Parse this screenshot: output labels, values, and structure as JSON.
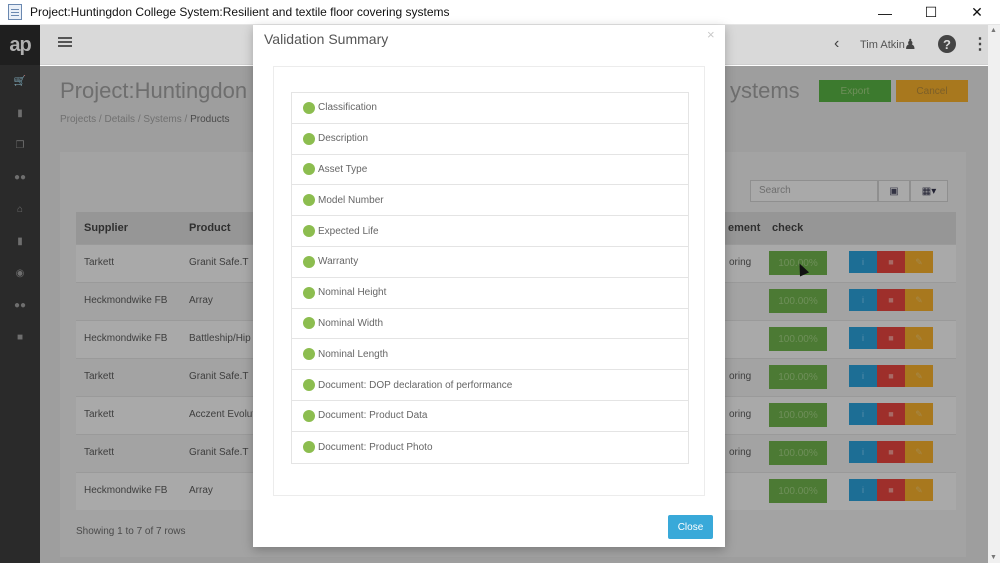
{
  "window": {
    "title": "Project:Huntingdon College System:Resilient and textile floor covering systems",
    "minimize": "—",
    "maximize": "☐",
    "close": "✕"
  },
  "sidebar": {
    "logo": "ap",
    "icons": [
      "cart-icon",
      "document-icon",
      "copy-icon",
      "users-icon",
      "home-icon",
      "file-icon",
      "globe-icon",
      "group-icon",
      "lock-icon"
    ]
  },
  "header": {
    "user_name": "Tim Atkin",
    "help": "?"
  },
  "page": {
    "title_left": "Project:Huntingdon C",
    "title_right": "ystems",
    "breadcrumbs": [
      "Projects",
      "/",
      "Details",
      "/",
      "Systems",
      "/",
      "Products"
    ],
    "export_label": "Export",
    "cancel_label": "Cancel",
    "search_placeholder": "Search",
    "columns": {
      "supplier": "Supplier",
      "product": "Product",
      "ement": "ement",
      "check": "check"
    },
    "rows": [
      {
        "supplier": "Tarkett",
        "product": "Granit Safe.T",
        "side": "oring",
        "pct": "100.00%"
      },
      {
        "supplier": "Heckmondwike FB",
        "product": "Array",
        "side": "",
        "pct": "100.00%"
      },
      {
        "supplier": "Heckmondwike FB",
        "product": "Battleship/Hip",
        "side": "",
        "pct": "100.00%"
      },
      {
        "supplier": "Tarkett",
        "product": "Granit Safe.T",
        "side": "oring",
        "pct": "100.00%"
      },
      {
        "supplier": "Tarkett",
        "product": "Acczent Evolut",
        "side": "oring",
        "pct": "100.00%"
      },
      {
        "supplier": "Tarkett",
        "product": "Granit Safe.T",
        "side": "oring",
        "pct": "100.00%"
      },
      {
        "supplier": "Heckmondwike FB",
        "product": "Array",
        "side": "",
        "pct": "100.00%"
      }
    ],
    "footer": "Showing 1 to 7 of 7 rows"
  },
  "modal": {
    "title": "Validation Summary",
    "close_x": "×",
    "items": [
      "Classification",
      "Description",
      "Asset Type",
      "Model Number",
      "Expected Life",
      "Warranty",
      "Nominal Height",
      "Nominal Width",
      "Nominal Length",
      "Document: DOP declaration of performance",
      "Document: Product Data",
      "Document: Product Photo"
    ],
    "close_button": "Close",
    "status_color": "#8cbd4f"
  }
}
